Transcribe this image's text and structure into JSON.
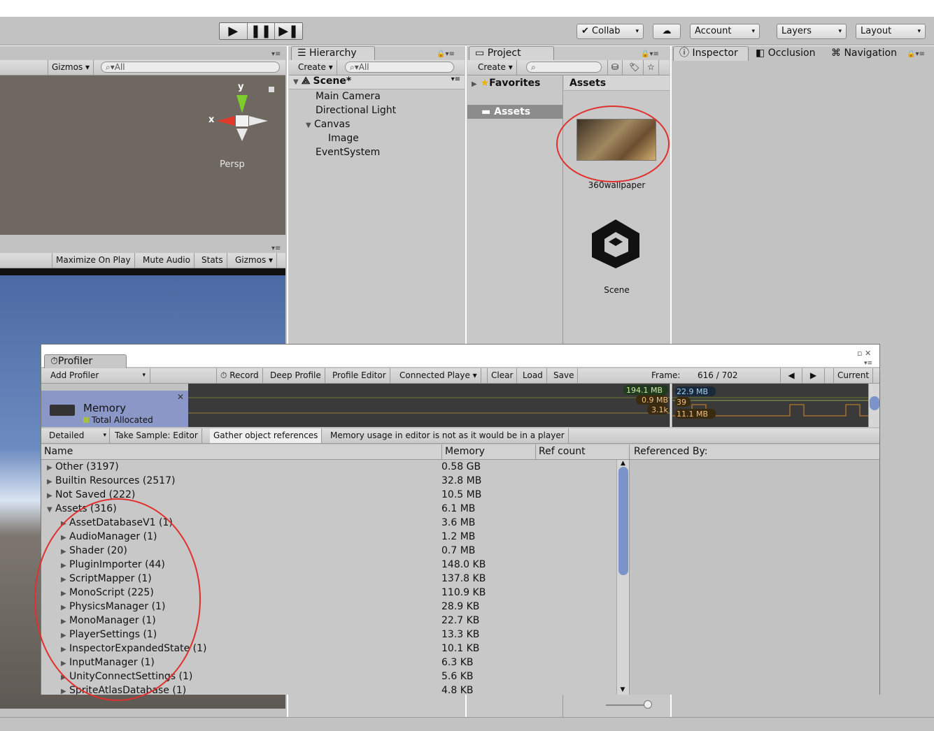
{
  "toolbar": {
    "collab": "Collab",
    "account": "Account",
    "layers": "Layers",
    "layout": "Layout"
  },
  "scene_view": {
    "gizmos": "Gizmos",
    "search_placeholder": "All",
    "gizmo_y": "y",
    "gizmo_x": "x",
    "persp": "Persp"
  },
  "game_view": {
    "maximize": "Maximize On Play",
    "mute": "Mute Audio",
    "stats": "Stats",
    "gizmos": "Gizmos"
  },
  "hierarchy": {
    "tab": "Hierarchy",
    "create": "Create",
    "search_placeholder": "All",
    "scene": "Scene*",
    "items": [
      "Main Camera",
      "Directional Light",
      "Canvas",
      "Image",
      "EventSystem"
    ]
  },
  "project": {
    "tab": "Project",
    "create": "Create",
    "favorites": "Favorites",
    "assets_folder": "Assets",
    "breadcrumb": "Assets",
    "assets": [
      {
        "name": "360wallpaper",
        "icon": "image-thumbnail-icon"
      },
      {
        "name": "Scene",
        "icon": "unity-logo-icon"
      }
    ]
  },
  "inspector": {
    "tab": "Inspector",
    "occlusion": "Occlusion",
    "navigation": "Navigation"
  },
  "profiler": {
    "tab": "Profiler",
    "add_profiler": "Add Profiler",
    "record": "Record",
    "deep_profile": "Deep Profile",
    "profile_editor": "Profile Editor",
    "connected_player": "Connected Playe",
    "clear": "Clear",
    "load": "Load",
    "save": "Save",
    "frame_label": "Frame:",
    "frame_value": "616 / 702",
    "current": "Current",
    "memory_module": "Memory",
    "total_allocated": "Total Allocated",
    "graph_labels": [
      "194.1 MB",
      "0.9 MB",
      "3.1k",
      "22.9 MB",
      "39",
      "11.1 MB"
    ],
    "detailed": "Detailed",
    "take_sample": "Take Sample: Editor",
    "gather_refs": "Gather object references",
    "notice": "Memory usage in editor is not as it would be in a player",
    "columns": {
      "name": "Name",
      "memory": "Memory",
      "refcount": "Ref count",
      "referenced_by": "Referenced By:"
    },
    "rows": [
      {
        "name": "Other (3197)",
        "memory": "0.58 GB",
        "indent": 0,
        "open": false
      },
      {
        "name": "Builtin Resources (2517)",
        "memory": "32.8 MB",
        "indent": 0,
        "open": false
      },
      {
        "name": "Not Saved (222)",
        "memory": "10.5 MB",
        "indent": 0,
        "open": false
      },
      {
        "name": "Assets (316)",
        "memory": "6.1 MB",
        "indent": 0,
        "open": true
      },
      {
        "name": "AssetDatabaseV1 (1)",
        "memory": "3.6 MB",
        "indent": 1,
        "open": false
      },
      {
        "name": "AudioManager (1)",
        "memory": "1.2 MB",
        "indent": 1,
        "open": false
      },
      {
        "name": "Shader (20)",
        "memory": "0.7 MB",
        "indent": 1,
        "open": false
      },
      {
        "name": "PluginImporter (44)",
        "memory": "148.0 KB",
        "indent": 1,
        "open": false
      },
      {
        "name": "ScriptMapper (1)",
        "memory": "137.8 KB",
        "indent": 1,
        "open": false
      },
      {
        "name": "MonoScript (225)",
        "memory": "110.9 KB",
        "indent": 1,
        "open": false
      },
      {
        "name": "PhysicsManager (1)",
        "memory": "28.9 KB",
        "indent": 1,
        "open": false
      },
      {
        "name": "MonoManager (1)",
        "memory": "22.7 KB",
        "indent": 1,
        "open": false
      },
      {
        "name": "PlayerSettings (1)",
        "memory": "13.3 KB",
        "indent": 1,
        "open": false
      },
      {
        "name": "InspectorExpandedState (1)",
        "memory": "10.1 KB",
        "indent": 1,
        "open": false
      },
      {
        "name": "InputManager (1)",
        "memory": "6.3 KB",
        "indent": 1,
        "open": false
      },
      {
        "name": "UnityConnectSettings (1)",
        "memory": "5.6 KB",
        "indent": 1,
        "open": false
      },
      {
        "name": "SpriteAtlasDatabase (1)",
        "memory": "4.8 KB",
        "indent": 1,
        "open": false
      }
    ]
  },
  "colors": {
    "panel": "#c2c2c2",
    "annotation": "#e0302e",
    "selection": "#3d6fd8"
  }
}
